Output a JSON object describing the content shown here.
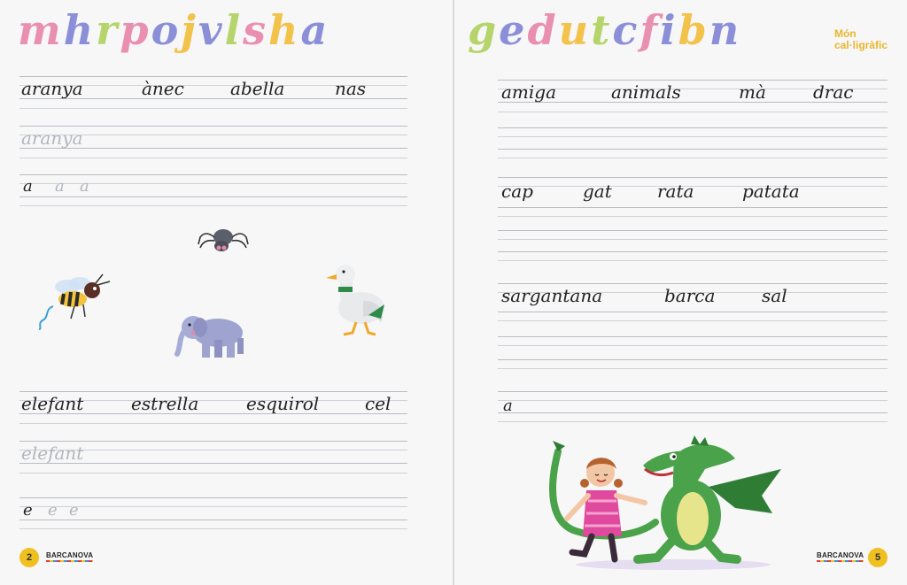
{
  "header": {
    "left_letters": [
      {
        "ch": "m",
        "color": "#e98fb0"
      },
      {
        "ch": "h",
        "color": "#8a8fd8"
      },
      {
        "ch": "r",
        "color": "#b5d46a"
      },
      {
        "ch": "p",
        "color": "#e98fb0"
      },
      {
        "ch": "o",
        "color": "#8a8fd8"
      },
      {
        "ch": "j",
        "color": "#f2c24a"
      },
      {
        "ch": "v",
        "color": "#8a8fd8"
      },
      {
        "ch": "l",
        "color": "#b5d46a"
      },
      {
        "ch": "s",
        "color": "#e98fb0"
      },
      {
        "ch": "h",
        "color": "#f2c24a"
      },
      {
        "ch": "a",
        "color": "#8a8fd8"
      }
    ],
    "right_letters": [
      {
        "ch": "g",
        "color": "#b5d46a"
      },
      {
        "ch": "e",
        "color": "#8a8fd8"
      },
      {
        "ch": "d",
        "color": "#e98fb0"
      },
      {
        "ch": "u",
        "color": "#f2c24a"
      },
      {
        "ch": "t",
        "color": "#b5d46a"
      },
      {
        "ch": "c",
        "color": "#8a8fd8"
      },
      {
        "ch": "f",
        "color": "#e98fb0"
      },
      {
        "ch": "i",
        "color": "#8a8fd8"
      },
      {
        "ch": "b",
        "color": "#f2c24a"
      },
      {
        "ch": "n",
        "color": "#8a8fd8"
      }
    ],
    "brand_line1": "Món",
    "brand_line2": "cal·ligràfic"
  },
  "left_page": {
    "row1_words": [
      "aranya",
      "ànec",
      "abella",
      "nas"
    ],
    "row2_trace": "aranya",
    "row3_letters": [
      "a",
      "a",
      "a"
    ],
    "row4_words": [
      "elefant",
      "estrella",
      "esquirol",
      "cel"
    ],
    "row5_trace": "elefant",
    "row6_letters": [
      "e",
      "e",
      "e"
    ],
    "page_number": "2",
    "publisher": "BARCANOVA"
  },
  "right_page": {
    "row1_words": [
      "amiga",
      "animals",
      "mà",
      "drac"
    ],
    "row2_words": [
      "cap",
      "gat",
      "rata",
      "patata"
    ],
    "row3_words": [
      "sargantana",
      "barca",
      "sal"
    ],
    "row4_letter": "a",
    "page_number": "5",
    "publisher": "BARCANOVA"
  }
}
